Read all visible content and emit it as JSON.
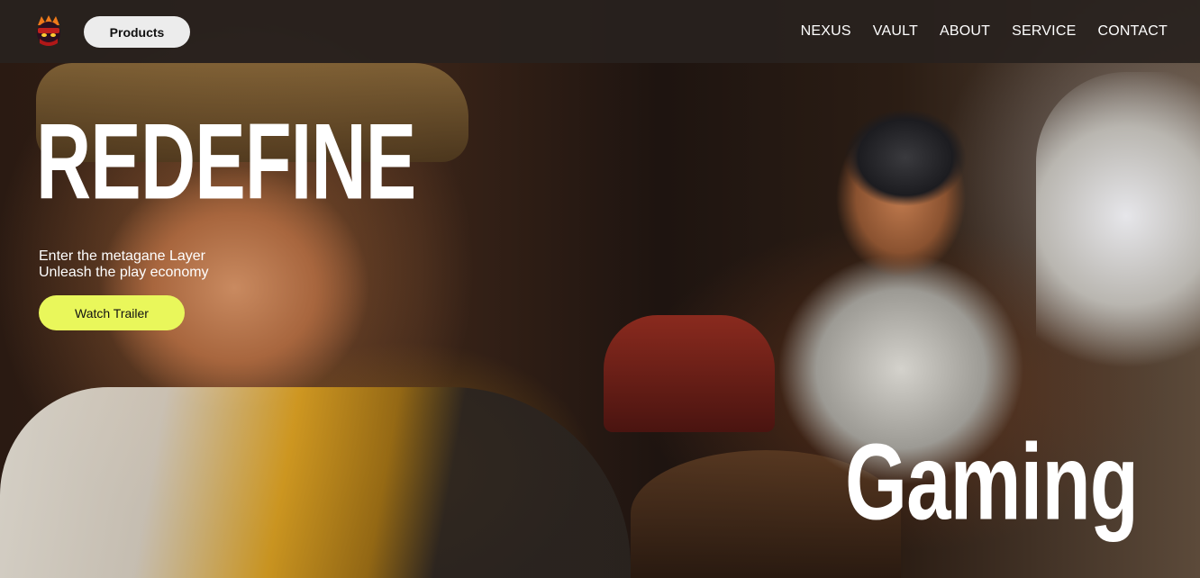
{
  "nav": {
    "products_label": "Products",
    "links": [
      "NEXUS",
      "VAULT",
      "ABOUT",
      "SERVICE",
      "CONTACT"
    ]
  },
  "hero": {
    "headline": "REDEFINE",
    "subtext_line1": "Enter the metagane Layer",
    "subtext_line2": "Unleash the play economy",
    "cta_label": "Watch Trailer",
    "bottom_word": "Gaming"
  },
  "colors": {
    "cta_background": "#e9f75b",
    "products_background": "#ececec",
    "navbar_background": "#28221e"
  },
  "icons": {
    "logo": "ninja-mascot-icon"
  }
}
